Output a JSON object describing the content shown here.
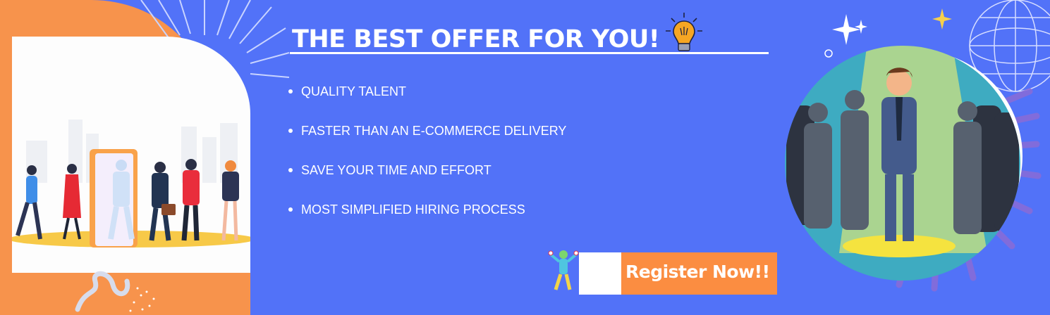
{
  "banner": {
    "heading": "THE BEST OFFER FOR YOU!",
    "features": [
      "QUALITY TALENT",
      "FASTER THAN AN E-COMMERCE DELIVERY",
      "SAVE YOUR TIME AND EFFORT",
      "MOST SIMPLIFIED HIRING PROCESS"
    ],
    "cta_label": "Register Now!!"
  },
  "colors": {
    "background": "#5272f8",
    "accent_orange": "#f7934c",
    "button": "#fb8d41",
    "text": "#ffffff"
  },
  "icons": [
    "lightbulb-icon",
    "play-icon",
    "sparkle-icon",
    "globe-icon"
  ]
}
